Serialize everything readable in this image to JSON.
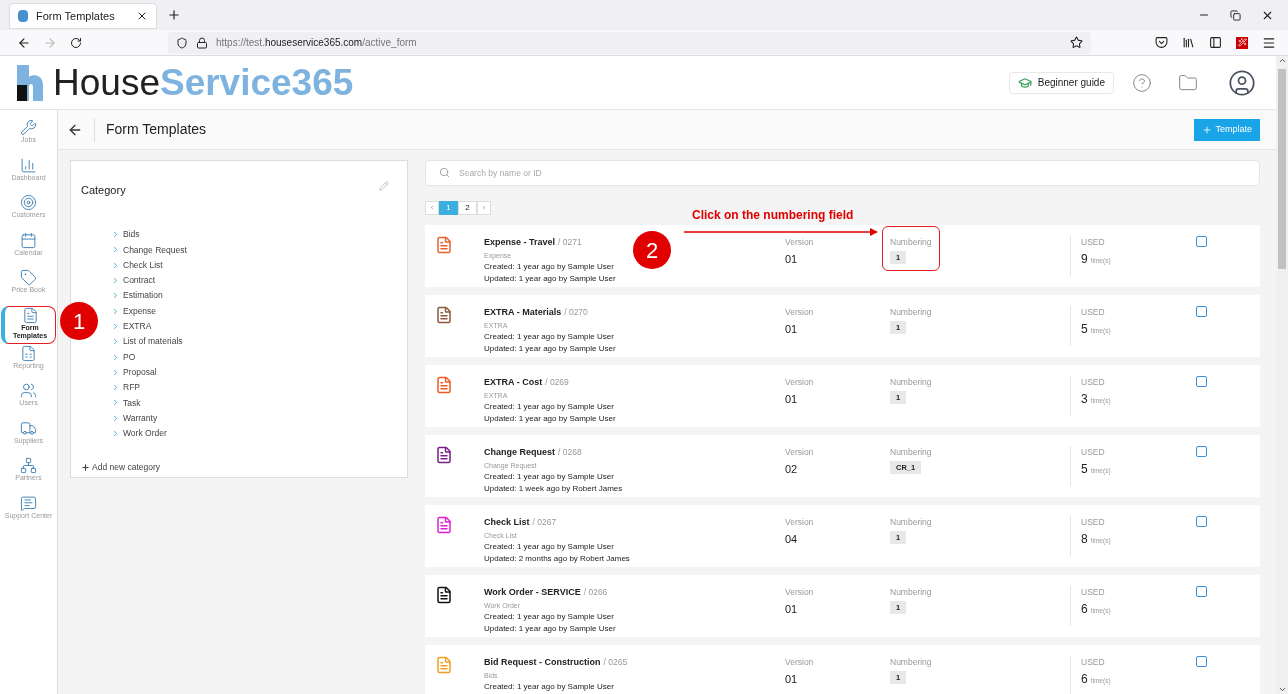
{
  "browser": {
    "tab_title": "Form Templates",
    "url": {
      "prefix": "https://test.",
      "domain": "houseservice365.com",
      "path": "/active_form"
    },
    "forward_disabled": true
  },
  "header": {
    "logo": {
      "part1": "House",
      "part2": "Service365"
    },
    "beginner_guide": "Beginner guide"
  },
  "sidebar": {
    "items": [
      {
        "label": "Jobs",
        "selected": false,
        "highlighted": false
      },
      {
        "label": "Dashboard",
        "selected": false,
        "highlighted": false
      },
      {
        "label": "Customers",
        "selected": false,
        "highlighted": false
      },
      {
        "label": "Calendar",
        "selected": false,
        "highlighted": false
      },
      {
        "label": "Price Book",
        "selected": false,
        "highlighted": false
      },
      {
        "label": "Form Templates",
        "selected": true,
        "highlighted": true
      },
      {
        "label": "Reporting",
        "selected": false,
        "highlighted": false
      },
      {
        "label": "Users",
        "selected": false,
        "highlighted": false
      },
      {
        "label": "Suppliers",
        "selected": false,
        "highlighted": false
      },
      {
        "label": "Partners",
        "selected": false,
        "highlighted": false
      },
      {
        "label": "Support Center",
        "selected": false,
        "highlighted": false
      }
    ]
  },
  "page_title": "Form Templates",
  "add_button": "Template",
  "category_panel": {
    "title": "Category",
    "categories": [
      "Bids",
      "Change Request",
      "Check List",
      "Contract",
      "Estimation",
      "Expense",
      "EXTRA",
      "List of materials",
      "PO",
      "Proposal",
      "RFP",
      "Task",
      "Warranty",
      "Work Order"
    ],
    "add_category": "Add new category"
  },
  "search": {
    "placeholder": "Search by name or ID"
  },
  "pagination": {
    "prev": "‹",
    "next": "›",
    "pages": [
      {
        "label": "1",
        "selected": true
      },
      {
        "label": "2",
        "selected": false
      }
    ]
  },
  "templates": [
    {
      "title": "Expense - Travel",
      "id": "/ 0271",
      "category": "Expense",
      "created": "Created: 1 year ago by Sample User",
      "updated": "Updated: 1 year ago by Sample User",
      "version_label": "Version",
      "version": "01",
      "numbering_label": "Numbering",
      "numbering": "1",
      "numbering_highlighted": true,
      "used_label": "USED",
      "used": "9",
      "used_unit": "time(s)",
      "color": "#e8622a",
      "checked": false
    },
    {
      "title": "EXTRA - Materials",
      "id": "/ 0270",
      "category": "EXTRA",
      "created": "Created: 1 year ago by Sample User",
      "updated": "Updated: 1 year ago by Sample User",
      "version_label": "Version",
      "version": "01",
      "numbering_label": "Numbering",
      "numbering": "1",
      "numbering_highlighted": false,
      "used_label": "USED",
      "used": "5",
      "used_unit": "time(s)",
      "color": "#8b5a3c",
      "checked": false
    },
    {
      "title": "EXTRA - Cost",
      "id": "/ 0269",
      "category": "EXTRA",
      "created": "Created: 1 year ago by Sample User",
      "updated": "Updated: 1 year ago by Sample User",
      "version_label": "Version",
      "version": "01",
      "numbering_label": "Numbering",
      "numbering": "1",
      "numbering_highlighted": false,
      "used_label": "USED",
      "used": "3",
      "used_unit": "time(s)",
      "color": "#f05a22",
      "checked": false
    },
    {
      "title": "Change Request",
      "id": "/ 0268",
      "category": "Change Request",
      "created": "Created: 1 year ago by Sample User",
      "updated": "Updated: 1 week ago by Robert James",
      "version_label": "Version",
      "version": "02",
      "numbering_label": "Numbering",
      "numbering": "CR_1",
      "numbering_highlighted": false,
      "used_label": "USED",
      "used": "5",
      "used_unit": "time(s)",
      "color": "#7a1f8a",
      "checked": false
    },
    {
      "title": "Check List",
      "id": "/ 0267",
      "category": "Check List",
      "created": "Created: 1 year ago by Sample User",
      "updated": "Updated: 2 months ago by Robert James",
      "version_label": "Version",
      "version": "04",
      "numbering_label": "Numbering",
      "numbering": "1",
      "numbering_highlighted": false,
      "used_label": "USED",
      "used": "8",
      "used_unit": "time(s)",
      "color": "#e01fd0",
      "checked": false
    },
    {
      "title": "Work Order - SERVICE",
      "id": "/ 0266",
      "category": "Work Order",
      "created": "Created: 1 year ago by Sample User",
      "updated": "Updated: 1 year ago by Sample User",
      "version_label": "Version",
      "version": "01",
      "numbering_label": "Numbering",
      "numbering": "1",
      "numbering_highlighted": false,
      "used_label": "USED",
      "used": "6",
      "used_unit": "time(s)",
      "color": "#111111",
      "checked": false
    },
    {
      "title": "Bid Request - Construction",
      "id": "/ 0265",
      "category": "Bids",
      "created": "Created: 1 year ago by Sample User",
      "version_label": "Version",
      "version": "01",
      "numbering_label": "Numbering",
      "numbering": "1",
      "numbering_highlighted": false,
      "used_label": "USED",
      "used": "6",
      "used_unit": "time(s)",
      "color": "#f0a020",
      "checked": false
    }
  ],
  "annotations": [
    {
      "number": "1"
    },
    {
      "number": "2",
      "text": "Click on the numbering field"
    }
  ]
}
